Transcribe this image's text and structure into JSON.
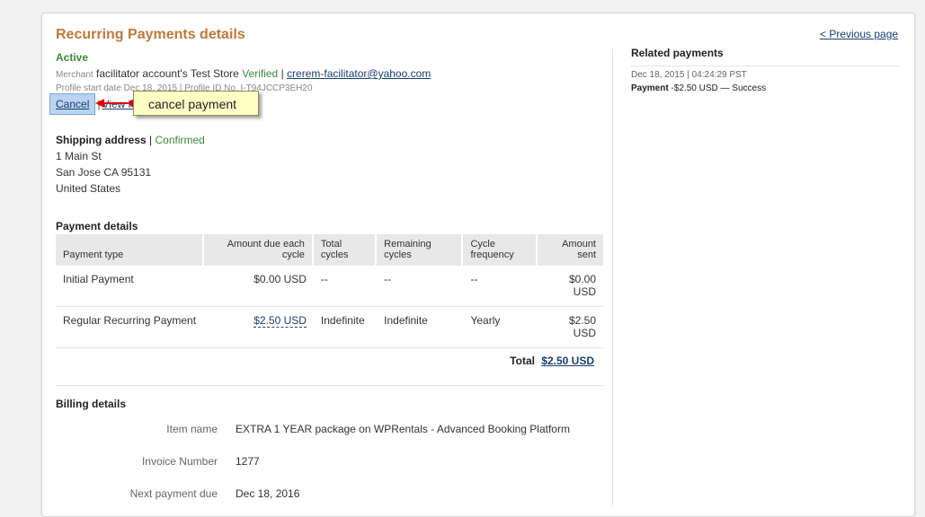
{
  "header": {
    "title": "Recurring Payments details",
    "previous_page": "< Previous page",
    "status": "Active"
  },
  "merchant": {
    "label": "Merchant",
    "name": "facilitator account's Test Store",
    "verified": "Verified",
    "separator": "|",
    "email": "crerem-facilitator@yahoo.com"
  },
  "profile": {
    "text": "Profile start date Dec 18, 2015 | Profile ID No. I-T94JCCP3EH20"
  },
  "actions": {
    "cancel": "Cancel",
    "separator": "|",
    "view": "View h"
  },
  "annotation": {
    "text": "cancel payment",
    "arrow_color": "#e00000"
  },
  "shipping": {
    "title": "Shipping address",
    "separator": "|",
    "status": "Confirmed",
    "lines": [
      "1 Main St",
      "San Jose CA 95131",
      "United States"
    ]
  },
  "payment_details": {
    "title": "Payment details",
    "columns": [
      "Payment type",
      "Amount due each cycle",
      "Total cycles",
      "Remaining cycles",
      "Cycle frequency",
      "Amount sent"
    ],
    "rows": [
      {
        "type": "Initial Payment",
        "amount": "$0.00 USD",
        "total": "--",
        "remaining": "--",
        "frequency": "--",
        "sent": "$0.00 USD"
      },
      {
        "type": "Regular Recurring Payment",
        "amount": "$2.50 USD",
        "total": "Indefinite",
        "remaining": "Indefinite",
        "frequency": "Yearly",
        "sent": "$2.50 USD"
      }
    ],
    "total_label": "Total",
    "total_value": "$2.50 USD"
  },
  "billing": {
    "title": "Billing details",
    "fields": [
      {
        "label": "Item name",
        "value": "EXTRA 1 YEAR package on WPRentals - Advanced Booking Platform"
      },
      {
        "label": "Invoice Number",
        "value": "1277"
      },
      {
        "label": "Next payment due",
        "value": "Dec 18, 2016"
      }
    ]
  },
  "related": {
    "title": "Related payments",
    "date": "Dec 18, 2015 | 04:24:29 PST",
    "item_label": "Payment",
    "item_text": "-$2.50 USD — Success"
  },
  "colors": {
    "title": "#c0783a",
    "success": "#3a8a3a",
    "link": "#1a3e6e",
    "callout_bg": "#ffffc6"
  }
}
